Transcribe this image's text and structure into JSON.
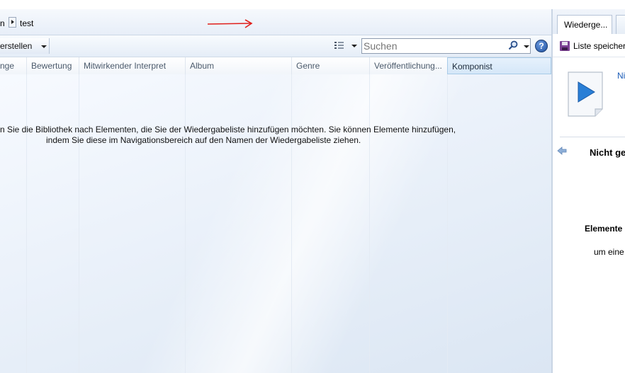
{
  "breadcrumb": {
    "previous": "n",
    "current": "test"
  },
  "toolbar": {
    "create_label": "erstellen"
  },
  "search": {
    "placeholder": "Suchen"
  },
  "columns": [
    "nge",
    "Bewertung",
    "Mitwirkender Interpret",
    "Album",
    "Genre",
    "Veröffentlichung...",
    "Komponist"
  ],
  "hint": {
    "line1": "n Sie die Bibliothek nach Elementen, die Sie der Wiedergabeliste hinzufügen möchten. Sie können Elemente hinzufügen,",
    "line2": "indem Sie diese im Navigationsbereich auf den Namen der Wiedergabeliste ziehen."
  },
  "right_pane": {
    "tab_label": "Wiederge...",
    "save_label": "Liste speichern",
    "now_playing_link": "Ni",
    "status_title": "Nicht ge",
    "elements_text": "Elemente",
    "drag_hint": "um eine"
  },
  "icons": {
    "play": "play-icon",
    "search": "magnifier-icon",
    "help": "help-icon",
    "save": "floppy-disk-icon",
    "back": "arrow-left-icon"
  },
  "colors": {
    "play_blue": "#2a7fd6",
    "annotation_red": "#e0201c",
    "link_blue": "#1c5db8"
  }
}
